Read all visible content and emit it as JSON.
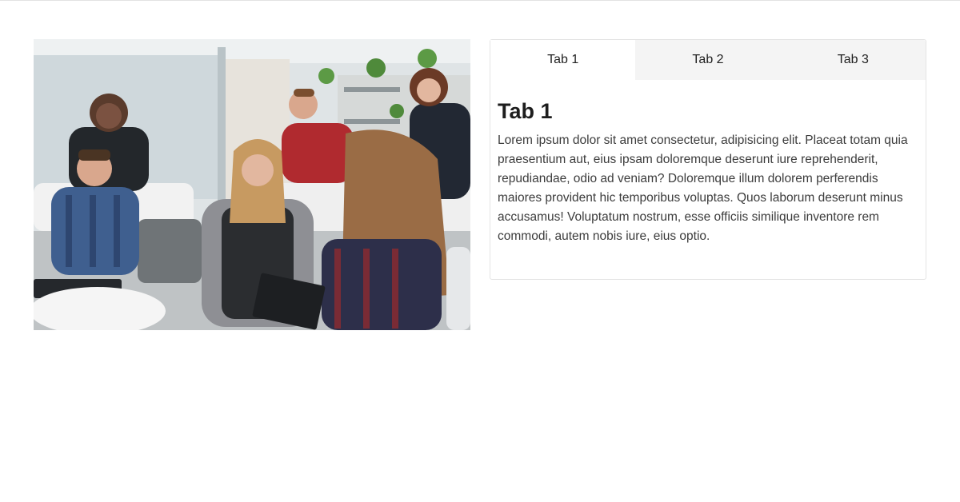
{
  "photo": {
    "subject": "team-meeting-photo"
  },
  "tabs": [
    {
      "label": "Tab 1",
      "active": true
    },
    {
      "label": "Tab 2",
      "active": false
    },
    {
      "label": "Tab 3",
      "active": false
    }
  ],
  "content": {
    "title": "Tab 1",
    "body": "Lorem ipsum dolor sit amet consectetur, adipisicing elit. Placeat totam quia praesentium aut, eius ipsam doloremque deserunt iure reprehenderit, repudiandae, odio ad veniam? Doloremque illum dolorem perferendis maiores provident hic temporibus voluptas. Quos laborum deserunt minus accusamus! Voluptatum nostrum, esse officiis similique inventore rem commodi, autem nobis iure, eius optio."
  },
  "colors": {
    "border": "#e3e3e3",
    "inactive_tab_bg": "#f4f4f4",
    "active_tab_bg": "#ffffff",
    "text": "#3c3c3c"
  }
}
